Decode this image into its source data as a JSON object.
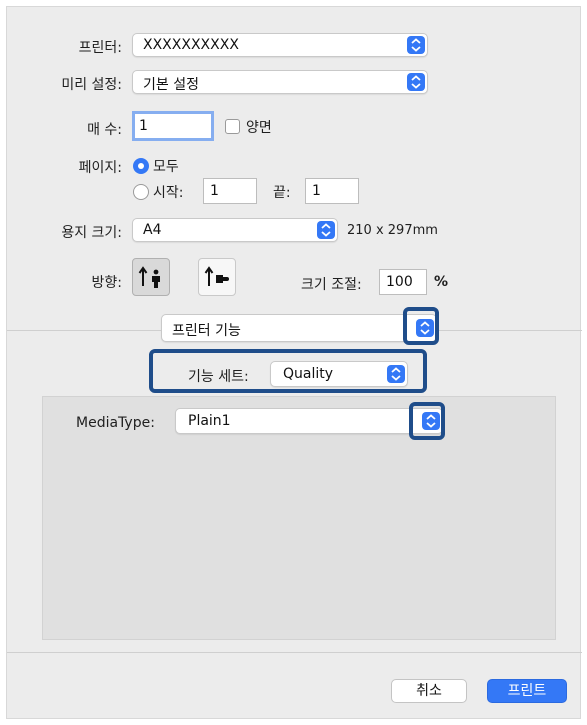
{
  "colors": {
    "accent": "#3478f6",
    "highlight": "#1f4d8a"
  },
  "printer": {
    "label": "프린터:",
    "value": "XXXXXXXXXX"
  },
  "presets": {
    "label": "미리 설정:",
    "value": "기본 설정"
  },
  "copies": {
    "label": "매 수:",
    "value": "1",
    "duplex_label": "양면",
    "duplex_checked": false
  },
  "pages": {
    "label": "페이지:",
    "all_label": "모두",
    "from_label": "시작:",
    "from_value": "1",
    "to_label": "끝:",
    "to_value": "1",
    "selected": "all"
  },
  "paper_size": {
    "label": "용지 크기:",
    "value": "A4",
    "dimensions": "210 x 297mm"
  },
  "orientation": {
    "label": "방향:",
    "selected": "portrait",
    "portrait_icon": "portrait-person-icon",
    "landscape_icon": "landscape-icon"
  },
  "scale": {
    "label": "크기 조절:",
    "value": "100",
    "unit": "%"
  },
  "section_menu": {
    "value": "프린터 기능"
  },
  "feature_set": {
    "label": "기능 세트:",
    "value": "Quality"
  },
  "media_type": {
    "label": "MediaType:",
    "value": "Plain1"
  },
  "buttons": {
    "cancel": "취소",
    "print": "프린트"
  }
}
